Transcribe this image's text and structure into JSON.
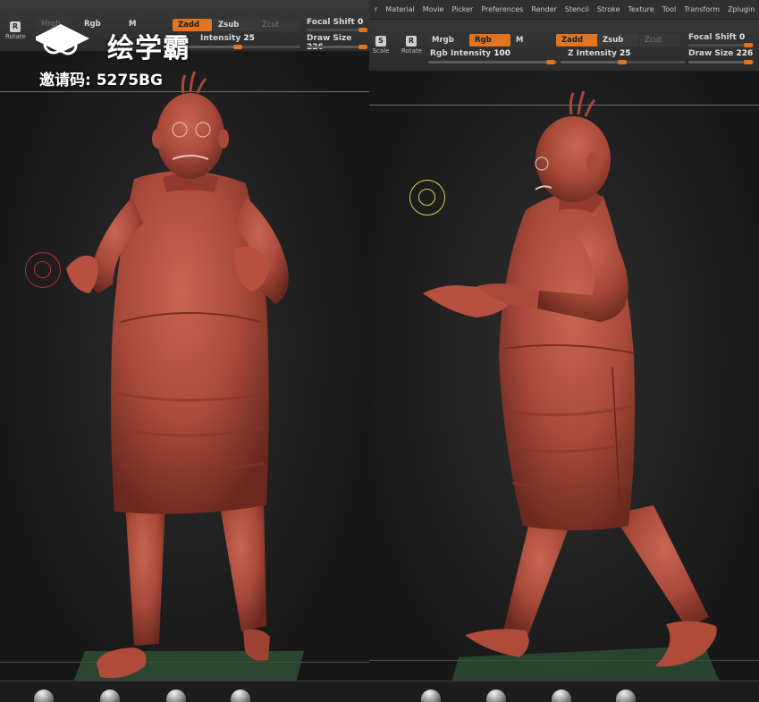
{
  "left_view": {
    "toolbar": {
      "rotate_label": "Rotate",
      "mrgb": "Mrgb",
      "rgb": "Rgb",
      "m": "M",
      "zadd": "Zadd",
      "zsub": "Zsub",
      "zcut": "Zcut",
      "z_intensity_label": "Intensity",
      "z_intensity_value": "25",
      "focal_shift_label": "Focal Shift",
      "focal_shift_value": "0",
      "draw_size_label": "Draw Size",
      "draw_size_value": "226"
    },
    "ui_balls": 4
  },
  "right_view": {
    "menu": [
      "r",
      "Material",
      "Movie",
      "Picker",
      "Preferences",
      "Render",
      "Stencil",
      "Stroke",
      "Texture",
      "Tool",
      "Transform",
      "Zplugin"
    ],
    "toolbar": {
      "scale_label": "Scale",
      "rotate_label": "Rotate",
      "mrgb": "Mrgb",
      "rgb": "Rgb",
      "m": "M",
      "zadd": "Zadd",
      "zsub": "Zsub",
      "zcut": "Zcut",
      "rgb_intensity_label": "Rgb Intensity",
      "rgb_intensity_value": "100",
      "z_intensity_label": "Z Intensity",
      "z_intensity_value": "25",
      "focal_shift_label": "Focal Shift",
      "focal_shift_value": "0",
      "draw_size_label": "Draw Size",
      "draw_size_value": "226"
    },
    "ui_balls": 4
  },
  "watermark": {
    "brand": "绘学霸",
    "invite_code": "邀请码: 5275BG"
  },
  "colors": {
    "accent": "#e3741f",
    "clay": "#a8493a",
    "brush_left": "#b53030",
    "brush_right": "#d8d34a",
    "floor_grid": "#3f6a44"
  }
}
